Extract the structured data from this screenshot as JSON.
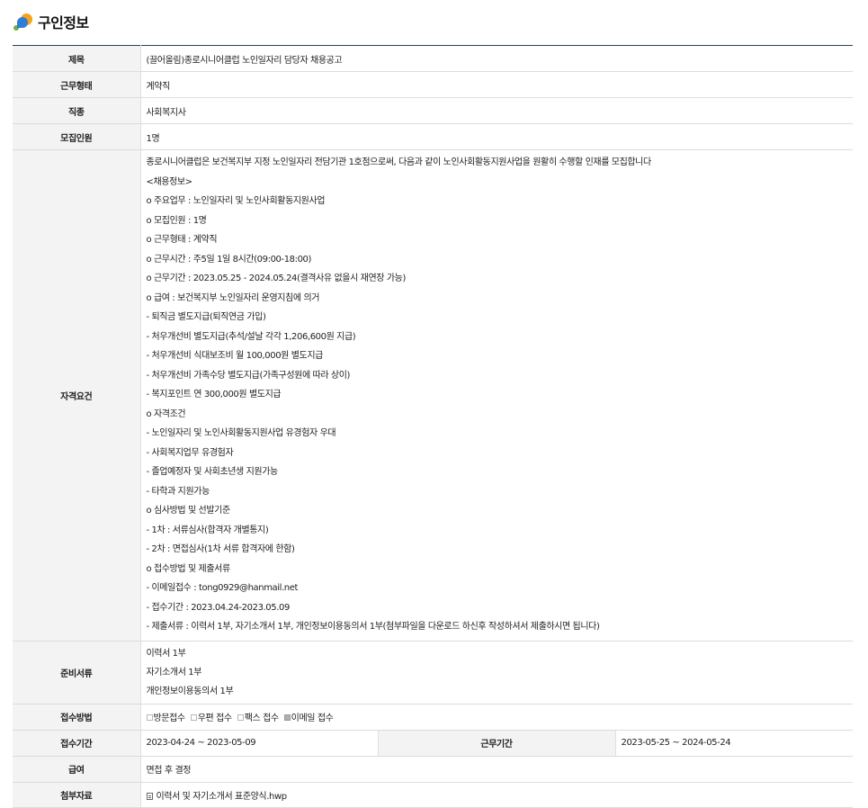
{
  "header": {
    "title": "구인정보"
  },
  "rows": {
    "title": {
      "label": "제목",
      "value": "(끌어올림)종로시니어클럽 노인일자리 담당자 채용공고"
    },
    "work_type": {
      "label": "근무형태",
      "value": "계약직"
    },
    "job": {
      "label": "직종",
      "value": "사회복지사"
    },
    "headcount": {
      "label": "모집인원",
      "value": "1명"
    },
    "qualification": {
      "label": "자격요건",
      "lines": [
        "종로시니어클럽은 보건복지부 지정 노인일자리 전담기관 1호점으로써, 다음과 같이 노인사회활동지원사업을 원활히 수행할 인재를 모집합니다",
        "<채용정보>",
        " o 주요업무 : 노인일자리 및 노인사회활동지원사업",
        " o 모집인원 : 1명",
        " o 근무형태 : 계약직",
        " o 근무시간 : 주5일 1일 8시간(09:00-18:00)",
        " o 근무기간 : 2023.05.25 - 2024.05.24(결격사유 없을시 재연장 가능)",
        " o  급여 : 보건복지부 노인일자리 운영지침에 의거",
        " - 퇴직금 별도지급(퇴직연금 가입)",
        " - 처우개선비 별도지급(추석/설날 각각 1,206,600원 지급)",
        " - 처우개선비 식대보조비 월 100,000원 별도지급",
        " - 처우개선비 가족수당 별도지급(가족구성원에 따라 상이)",
        " - 복지포인트 연 300,000원 별도지급",
        " o 자격조건",
        " - 노인일자리 및 노인사회활동지원사업 유경험자 우대",
        " - 사회복지업무 유경험자",
        " - 졸업예정자 및 사회초년생 지원가능",
        " - 타학과 지원가능",
        " o 심사방법 및 선발기준",
        " - 1차 : 서류심사(합격자 개별통지)",
        " - 2차 : 면접심사(1차 서류 합격자에 한함)",
        " o 접수방법 및 제출서류",
        " - 이메일접수 : tong0929@hanmail.net",
        " - 접수기간 : 2023.04.24-2023.05.09",
        " - 제출서류 : 이력서 1부, 자기소개서 1부, 개인정보이용동의서 1부(첨부파일을 다운로드 하신후 작성하셔서 제출하시면 됩니다)"
      ]
    },
    "documents": {
      "label": "준비서류",
      "lines": [
        "이력서 1부",
        "자기소개서 1부",
        "개인정보이용동의서 1부"
      ]
    },
    "method": {
      "label": "접수방법",
      "options": [
        {
          "label": "방문접수",
          "checked": false
        },
        {
          "label": "우편 접수",
          "checked": false
        },
        {
          "label": "팩스 접수",
          "checked": false
        },
        {
          "label": "이메일 접수",
          "checked": true
        }
      ]
    },
    "period": {
      "label": "접수기간",
      "value": "2023-04-24 ~ 2023-05-09",
      "label2": "근무기간",
      "value2": "2023-05-25 ~ 2024-05-24"
    },
    "salary": {
      "label": "급여",
      "value": "면접 후 결정"
    },
    "attachment": {
      "label": "첨부자료",
      "value": "이력서 및 자기소개서 표준양식.hwp"
    }
  }
}
